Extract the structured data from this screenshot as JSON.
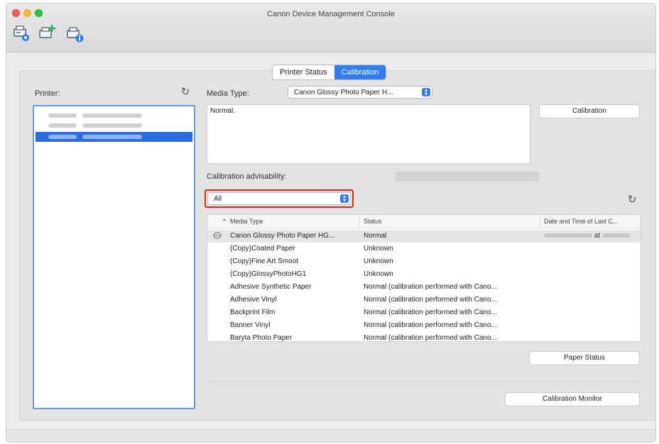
{
  "window": {
    "title": "Canon Device Management Console"
  },
  "toolbar": {
    "icons": [
      "printer-settings-icon",
      "add-printer-icon",
      "printer-info-icon"
    ]
  },
  "tabs": [
    {
      "label": "Printer Status",
      "active": false
    },
    {
      "label": "Calibration",
      "active": true
    }
  ],
  "printer_panel": {
    "label": "Printer:"
  },
  "media": {
    "label": "Media Type:",
    "selected": "Canon Glossy Photo Paper H...",
    "description": "Normal."
  },
  "buttons": {
    "calibration": "Calibration",
    "paper_status": "Paper Status",
    "calibration_monitor": "Calibration Monitor"
  },
  "advisability": {
    "label": "Calibration advisability:"
  },
  "filter": {
    "selected": "All"
  },
  "table": {
    "columns": [
      "Media Type",
      "Status",
      "Date and Time of Last C..."
    ],
    "rows": [
      {
        "media": "Canon Glossy Photo Paper HG...",
        "status": "Normal",
        "date_at": "at"
      },
      {
        "media": "(Copy)Coated Paper",
        "status": "Unknown",
        "date_at": ""
      },
      {
        "media": "(Copy)Fine Art Smoot",
        "status": "Unknown",
        "date_at": ""
      },
      {
        "media": "(Copy)GlossyPhotoHG1",
        "status": "Unknown",
        "date_at": ""
      },
      {
        "media": "Adhesive Synthetic Paper",
        "status": "Normal (calibration performed with Cano...",
        "date_at": ""
      },
      {
        "media": "Adhesive Vinyl",
        "status": "Normal (calibration performed with Cano...",
        "date_at": ""
      },
      {
        "media": "Backprint Film",
        "status": "Normal (calibration performed with Cano...",
        "date_at": ""
      },
      {
        "media": "Banner Vinyl",
        "status": "Normal (calibration performed with Cano...",
        "date_at": ""
      },
      {
        "media": "Baryta Photo Paper",
        "status": "Normal (calibration performed with Cano...",
        "date_at": ""
      }
    ]
  },
  "colors": {
    "accent": "#2f7cf6",
    "selection": "#2a6ce3",
    "highlight_border": "#e1261c"
  }
}
